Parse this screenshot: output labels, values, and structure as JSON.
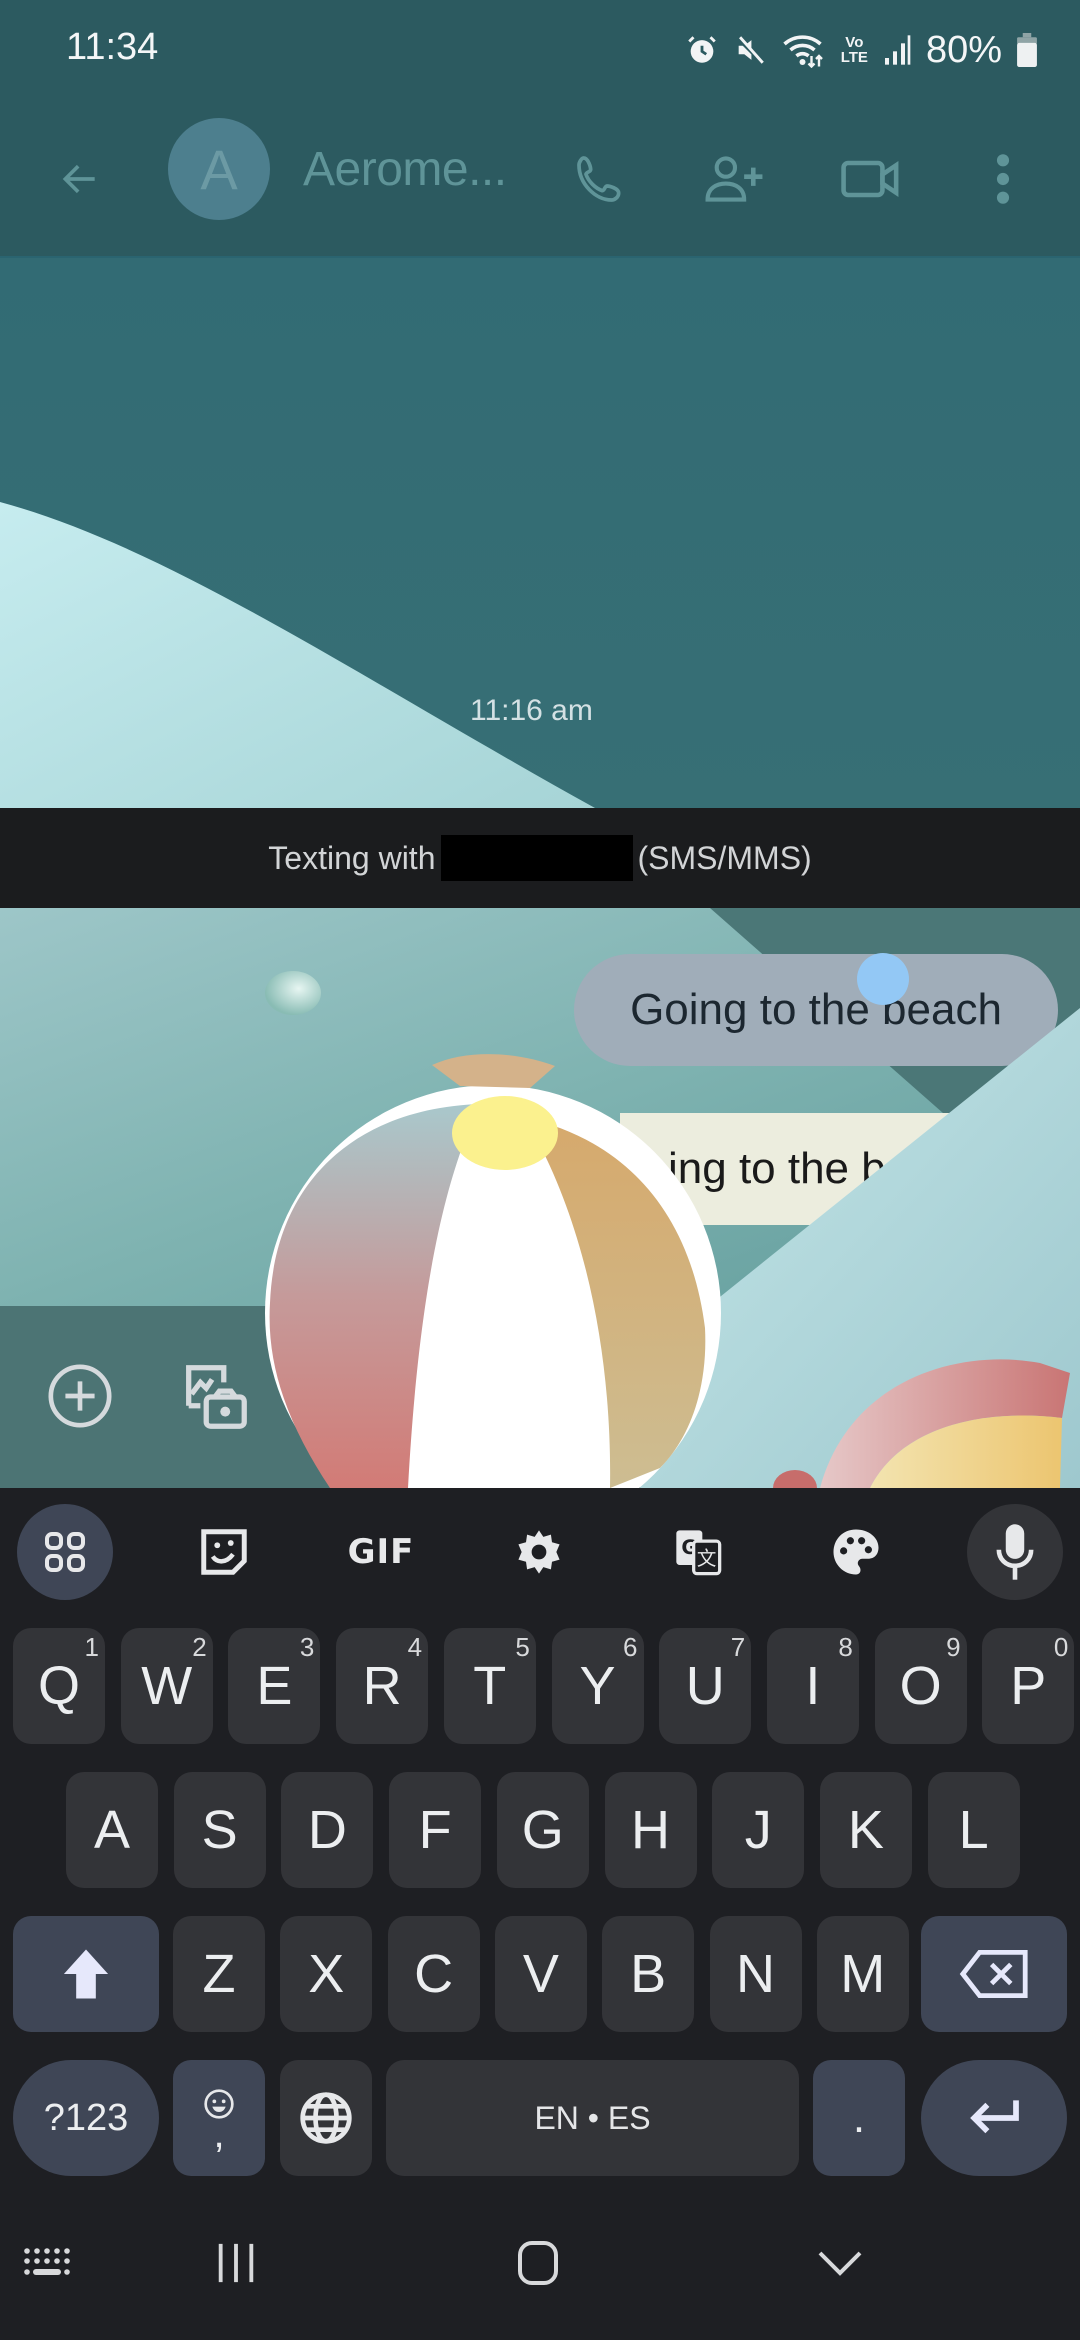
{
  "status_bar": {
    "time": "11:34",
    "icons": [
      "alarm-icon",
      "mute-icon",
      "wifi-icon",
      "volte-icon",
      "signal-icon"
    ],
    "volte_top": "Vo",
    "volte_bottom": "LTE",
    "battery_percent": "80%"
  },
  "app_bar": {
    "avatar_letter": "A",
    "contact_name": "Aerome...",
    "actions": [
      "back",
      "call",
      "add-person",
      "video-call",
      "more"
    ]
  },
  "conversation": {
    "timestamp": "11:16 am",
    "banner": {
      "prefix": "Texting with",
      "suffix": "(SMS/MMS)"
    },
    "messages": [
      {
        "direction": "sent",
        "text": "Going to the beach"
      }
    ],
    "effect_copy_text": "ing to the be"
  },
  "compose": {
    "actions": [
      "add",
      "gallery-camera"
    ]
  },
  "keyboard": {
    "toolbar": [
      "apps",
      "sticker",
      "GIF",
      "settings",
      "translate",
      "theme",
      "voice"
    ],
    "gif_label": "GIF",
    "rows": [
      [
        {
          "label": "Q",
          "hint": "1"
        },
        {
          "label": "W",
          "hint": "2"
        },
        {
          "label": "E",
          "hint": "3"
        },
        {
          "label": "R",
          "hint": "4"
        },
        {
          "label": "T",
          "hint": "5"
        },
        {
          "label": "Y",
          "hint": "6"
        },
        {
          "label": "U",
          "hint": "7"
        },
        {
          "label": "I",
          "hint": "8"
        },
        {
          "label": "O",
          "hint": "9"
        },
        {
          "label": "P",
          "hint": "0"
        }
      ],
      [
        {
          "label": "A"
        },
        {
          "label": "S"
        },
        {
          "label": "D"
        },
        {
          "label": "F"
        },
        {
          "label": "G"
        },
        {
          "label": "H"
        },
        {
          "label": "J"
        },
        {
          "label": "K"
        },
        {
          "label": "L"
        }
      ],
      [
        {
          "label": "Z"
        },
        {
          "label": "X"
        },
        {
          "label": "C"
        },
        {
          "label": "V"
        },
        {
          "label": "B"
        },
        {
          "label": "N"
        },
        {
          "label": "M"
        }
      ]
    ],
    "symbols_label": "?123",
    "comma_label": ",",
    "space_label": "EN • ES",
    "period_label": "."
  },
  "nav_bar": {
    "buttons": [
      "keyboard-switch",
      "recents",
      "home",
      "hide-keyboard"
    ]
  },
  "colors": {
    "header_bg": "#2c5a60",
    "conversation_bg": "#336c74",
    "banner_bg": "#1b1c1e",
    "sent_bubble": "#a0adb9",
    "keyboard_bg": "#1e1f23",
    "key_bg": "#333438",
    "mod_key_bg": "#3f4656"
  }
}
